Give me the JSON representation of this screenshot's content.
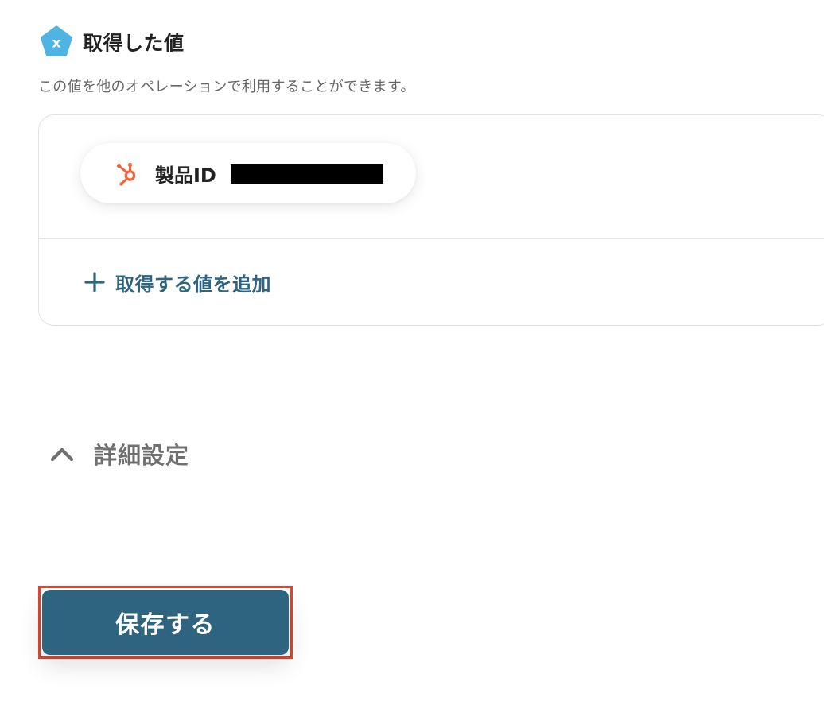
{
  "section": {
    "title": "取得した値",
    "description": "この値を他のオペレーションで利用することができます。",
    "badge_icon": "x-variable-icon"
  },
  "values": {
    "items": [
      {
        "label": "製品ID",
        "icon": "hubspot-icon",
        "value_redacted": true
      }
    ],
    "add_label": "取得する値を追加",
    "add_icon": "plus-icon"
  },
  "advanced": {
    "label": "詳細設定",
    "icon": "chevron-up-icon",
    "expanded": true
  },
  "actions": {
    "save_label": "保存する",
    "save_highlighted": true
  },
  "colors": {
    "primary": "#2e6480",
    "badge": "#4fb4e2",
    "hubspot": "#f0643a",
    "highlight": "#e5432d",
    "muted_text": "#707070"
  }
}
